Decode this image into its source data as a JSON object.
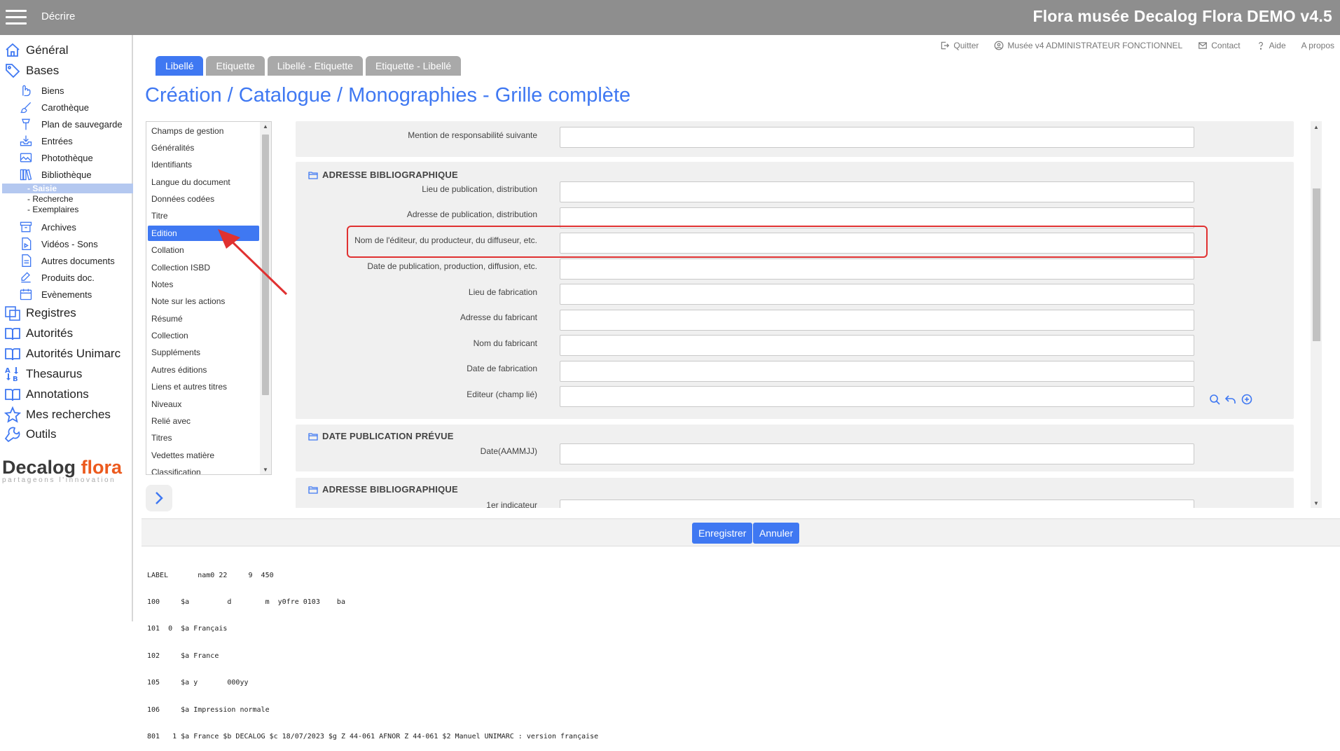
{
  "topbar": {
    "reduce_label": "Décrire",
    "app_title": "Flora musée Decalog Flora DEMO v4.5"
  },
  "sidebar": {
    "general": "Général",
    "bases": "Bases",
    "bases_items": [
      "Biens",
      "Carothèque",
      "Plan de sauvegarde",
      "Entrées",
      "Photothèque",
      "Bibliothèque"
    ],
    "bibliotheque_items": [
      "- Saisie",
      "- Recherche",
      "- Exemplaires"
    ],
    "bases_items2": [
      "Archives",
      "Vidéos - Sons",
      "Autres documents",
      "Produits doc.",
      "Evènements"
    ],
    "main_items": [
      "Registres",
      "Autorités",
      "Autorités Unimarc",
      "Thesaurus",
      "Annotations",
      "Mes recherches",
      "Outils"
    ],
    "logo": {
      "word1": "Decalog",
      "word2": "flora",
      "tagline": "partageons l'innovation"
    }
  },
  "header_links": [
    "Quitter",
    "Musée v4 ADMINISTRATEUR FONCTIONNEL",
    "Contact",
    "Aide",
    "A propos"
  ],
  "tabs": [
    "Libellé",
    "Etiquette",
    "Libellé - Etiquette",
    "Etiquette - Libellé"
  ],
  "page_title": "Création / Catalogue / Monographies - Grille complète",
  "sections": [
    "Champs de gestion",
    "Généralités",
    "Identifiants",
    "Langue du document",
    "Données codées",
    "Titre",
    "Edition",
    "Collation",
    "Collection ISBD",
    "Notes",
    "Note sur les actions",
    "Résumé",
    "Collection",
    "Suppléments",
    "Autres éditions",
    "Liens et autres titres",
    "Niveaux",
    "Relié avec",
    "Titres",
    "Vedettes matière",
    "Classification"
  ],
  "form": {
    "top_label": "Mention de responsabilité suivante",
    "fs1_title": "ADRESSE BIBLIOGRAPHIQUE",
    "fs1_fields": [
      "Lieu de publication, distribution",
      "Adresse de publication, distribution",
      "Nom de l'éditeur, du producteur, du diffuseur, etc.",
      "Date de publication, production, diffusion, etc.",
      "Lieu de fabrication",
      "Adresse du fabricant",
      "Nom du fabricant",
      "Date de fabrication",
      "Editeur (champ lié)"
    ],
    "fs2_title": "DATE PUBLICATION PRÉVUE",
    "fs2_fields": [
      "Date(AAMMJJ)"
    ],
    "fs3_title": "ADRESSE BIBLIOGRAPHIQUE",
    "fs3_fields": [
      "1er indicateur"
    ]
  },
  "buttons": {
    "save": "Enregistrer",
    "cancel": "Annuler"
  },
  "record_lines": [
    "LABEL       nam0 22     9  450",
    "100     $a         d        m  y0fre 0103    ba",
    "101  0  $a Français",
    "102     $a France",
    "105     $a y       000yy",
    "106     $a Impression normale",
    "801   1 $a France $b DECALOG $c 18/07/2023 $g Z 44-061 AFNOR Z 44-061 $2 Manuel UNIMARC : version française"
  ],
  "colors": {
    "accent": "#3f78f2",
    "topbar": "#8e8e8e",
    "highlight": "#e03131",
    "logo_orange": "#ec5a1e"
  }
}
